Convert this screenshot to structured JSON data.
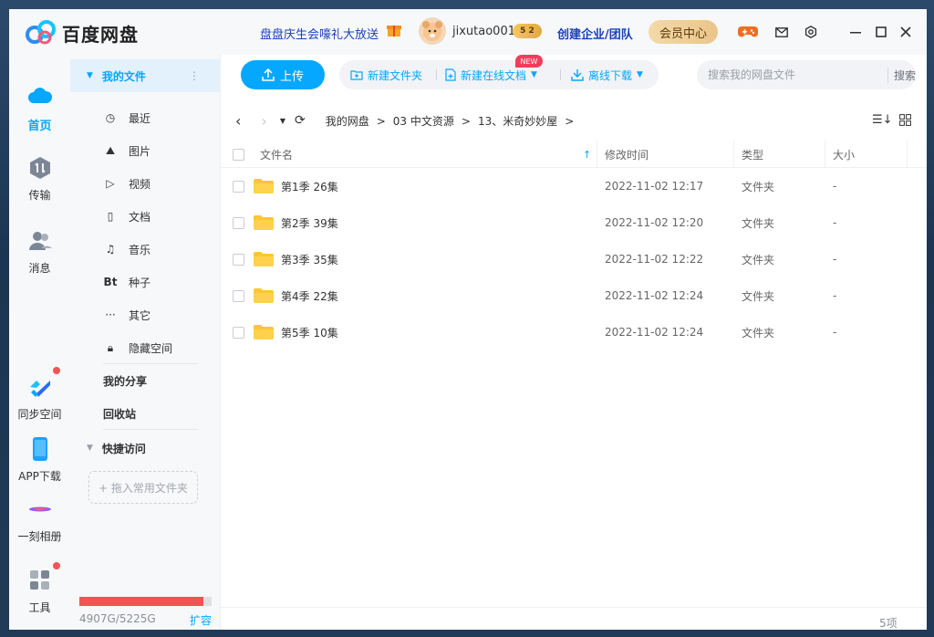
{
  "app": {
    "title": "百度网盘"
  },
  "titlebar": {
    "promo": "盘盘庆生会嚎礼大放送",
    "username": "jixutao001",
    "vip_level": "5 2",
    "create_enterprise": "创建企业/团队",
    "vip_center": "会员中心",
    "icons": [
      "gamepad-icon",
      "mail-icon",
      "settings-icon",
      "minimize-icon",
      "maximize-icon",
      "close-icon"
    ]
  },
  "leftnav": {
    "items": [
      {
        "label": "首页",
        "icon": "cloud-icon",
        "active": true
      },
      {
        "label": "传输",
        "icon": "transfer-icon"
      },
      {
        "label": "消息",
        "icon": "contacts-icon"
      },
      {
        "label": "同步空间",
        "icon": "sync-icon",
        "dot": true
      },
      {
        "label": "APP下载",
        "icon": "phone-icon"
      },
      {
        "label": "一刻相册",
        "icon": "album-icon"
      },
      {
        "label": "工具",
        "icon": "tools-icon",
        "dot": true
      }
    ]
  },
  "sidebar": {
    "my_files": "我的文件",
    "items": [
      {
        "label": "最近",
        "icon": "clock-icon"
      },
      {
        "label": "图片",
        "icon": "image-icon"
      },
      {
        "label": "视频",
        "icon": "play-icon"
      },
      {
        "label": "文档",
        "icon": "document-icon"
      },
      {
        "label": "音乐",
        "icon": "headphones-icon"
      },
      {
        "label": "种子",
        "icon": "bt-icon"
      },
      {
        "label": "其它",
        "icon": "more-icon"
      },
      {
        "label": "隐藏空间",
        "icon": "lock-icon"
      }
    ],
    "my_share": "我的分享",
    "recycle": "回收站",
    "quick_access": "快捷访问",
    "drop_hint": "+ 拖入常用文件夹",
    "quota_text": "4907G/5225G",
    "quota_fraction": 0.939,
    "expand": "扩容"
  },
  "toolbar": {
    "upload": "上传",
    "new_folder": "新建文件夹",
    "new_doc": "新建在线文档",
    "new_badge": "NEW",
    "offline_download": "离线下载",
    "search_placeholder": "搜索我的网盘文件",
    "search_button": "搜索"
  },
  "breadcrumb": [
    "我的网盘",
    "03 中文资源",
    "13、米奇妙妙屋"
  ],
  "table": {
    "headers": {
      "name": "文件名",
      "modified": "修改时间",
      "type": "类型",
      "size": "大小"
    },
    "rows": [
      {
        "name": "第1季 26集",
        "modified": "2022-11-02 12:17",
        "type": "文件夹",
        "size": "-"
      },
      {
        "name": "第2季 39集",
        "modified": "2022-11-02 12:20",
        "type": "文件夹",
        "size": "-"
      },
      {
        "name": "第3季 35集",
        "modified": "2022-11-02 12:22",
        "type": "文件夹",
        "size": "-"
      },
      {
        "name": "第4季 22集",
        "modified": "2022-11-02 12:24",
        "type": "文件夹",
        "size": "-"
      },
      {
        "name": "第5季 10集",
        "modified": "2022-11-02 12:24",
        "type": "文件夹",
        "size": "-"
      }
    ]
  },
  "footer": {
    "count": "5项"
  },
  "colors": {
    "accent": "#06a7ff",
    "quota": "#f25454",
    "folder": "#ffc533"
  }
}
